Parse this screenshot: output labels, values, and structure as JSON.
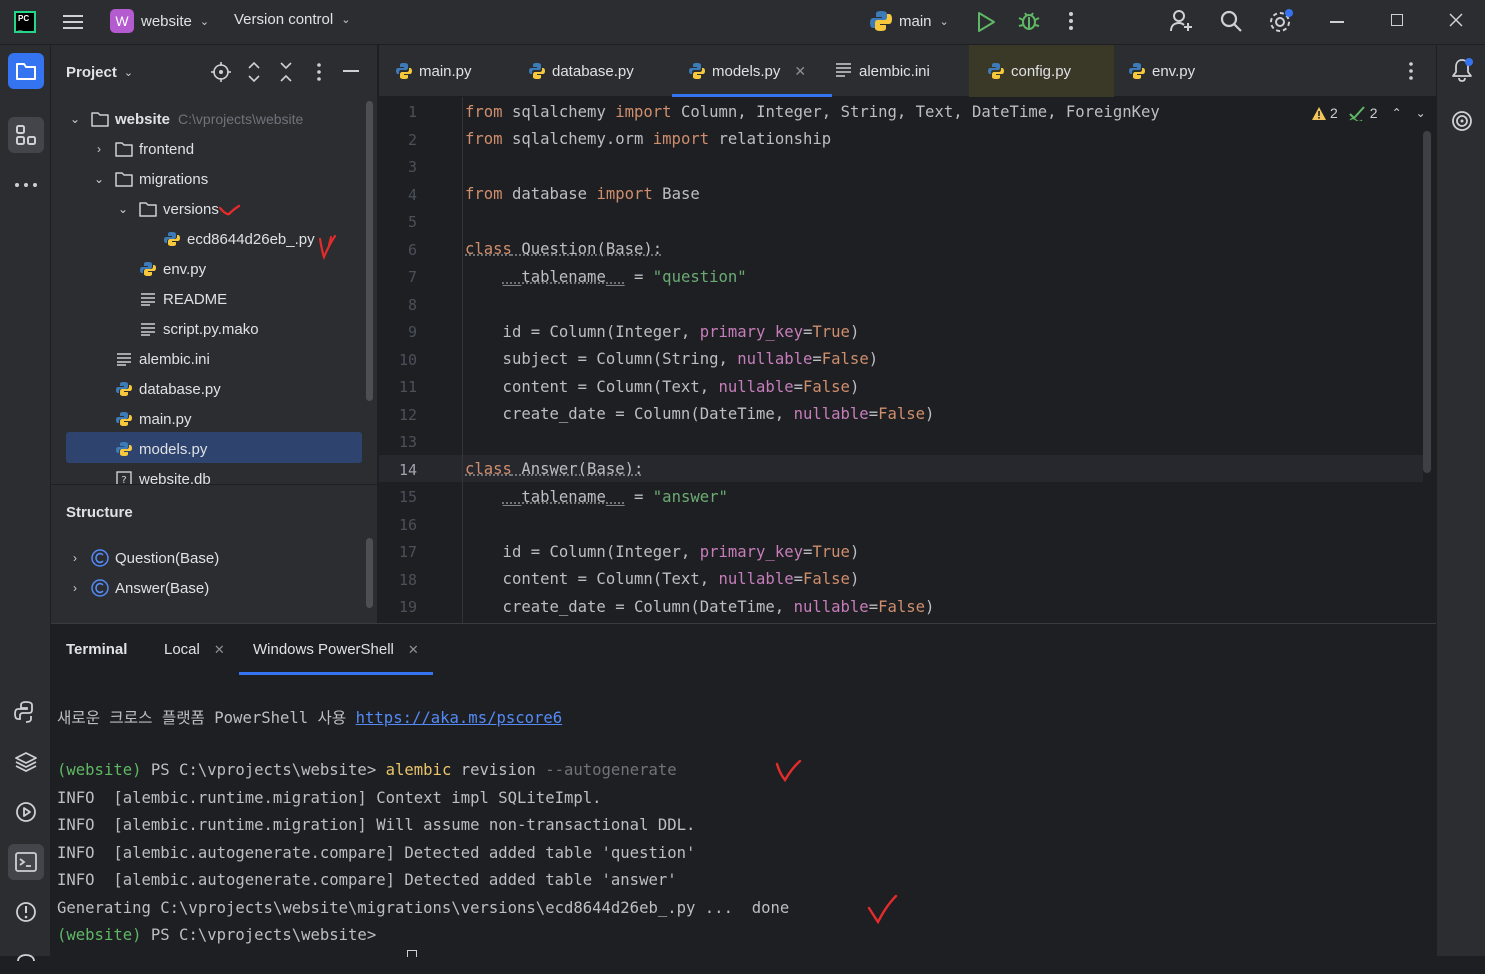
{
  "titlebar": {
    "project_badge": "W",
    "project_name": "website",
    "vcs_label": "Version control",
    "run_config": "main"
  },
  "project_panel": {
    "title": "Project",
    "root_name": "website",
    "root_path": "C:\\vprojects\\website",
    "items": [
      {
        "label": "frontend"
      },
      {
        "label": "migrations"
      },
      {
        "label": "versions"
      },
      {
        "label": "ecd8644d26eb_.py"
      },
      {
        "label": "env.py"
      },
      {
        "label": "README"
      },
      {
        "label": "script.py.mako"
      },
      {
        "label": "alembic.ini"
      },
      {
        "label": "database.py"
      },
      {
        "label": "main.py"
      },
      {
        "label": "models.py"
      },
      {
        "label": "website.db"
      }
    ]
  },
  "structure_panel": {
    "title": "Structure",
    "items": [
      {
        "label": "Question(Base)"
      },
      {
        "label": "Answer(Base)"
      }
    ]
  },
  "editor": {
    "tabs": [
      {
        "label": "main.py"
      },
      {
        "label": "database.py"
      },
      {
        "label": "models.py"
      },
      {
        "label": "alembic.ini"
      },
      {
        "label": "config.py"
      },
      {
        "label": "env.py"
      }
    ],
    "active_tab": "models.py",
    "warnings_count": "2",
    "ok_count": "2",
    "current_line": "14",
    "line_numbers": [
      "1",
      "2",
      "3",
      "4",
      "5",
      "6",
      "7",
      "8",
      "9",
      "10",
      "11",
      "12",
      "13",
      "14",
      "15",
      "16",
      "17",
      "18",
      "19"
    ]
  },
  "terminal": {
    "title": "Terminal",
    "tabs": [
      {
        "label": "Local"
      },
      {
        "label": "Windows PowerShell"
      }
    ],
    "lines": {
      "l1_text": "새로운 크로스 플랫폼 PowerShell 사용 ",
      "l1_link": "https://aka.ms/pscore6",
      "prompt_env": "(website)",
      "prompt_path": " PS C:\\vprojects\\website> ",
      "cmd_name": "alembic",
      "cmd_args": " revision ",
      "cmd_flag": "--autogenerate",
      "info1": "INFO  [alembic.runtime.migration] Context impl SQLiteImpl.",
      "info2": "INFO  [alembic.runtime.migration] Will assume non-transactional DDL.",
      "info3": "INFO  [alembic.autogenerate.compare] Detected added table 'question'",
      "info4": "INFO  [alembic.autogenerate.compare] Detected added table 'answer'",
      "gen": "Generating C:\\vprojects\\website\\migrations\\versions\\ecd8644d26eb_.py ...  done",
      "prompt2_path": " PS C:\\vprojects\\website>"
    }
  },
  "colors": {
    "keyword": "#cf8e6d",
    "string": "#6aab73",
    "param": "#c77dbb",
    "selection": "#2e436e",
    "annotation": "#e52b2b"
  }
}
